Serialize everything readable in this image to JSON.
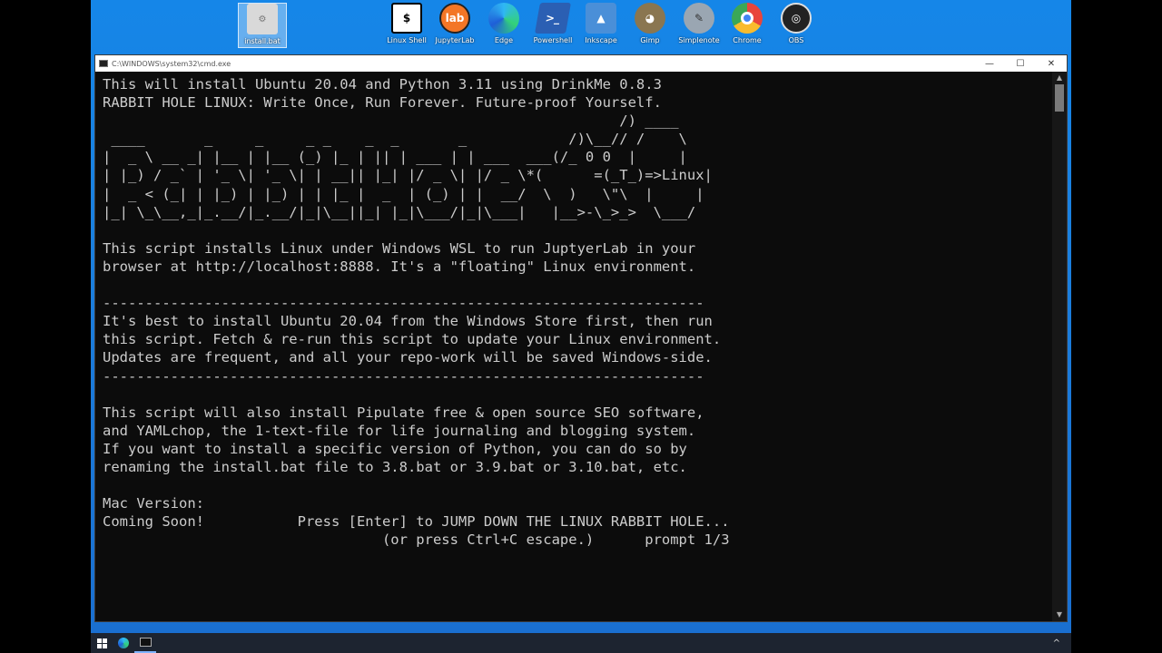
{
  "desktop": {
    "icons": [
      {
        "label": "install.bat",
        "icon": "batch-file-icon",
        "color": "#d9d9d9"
      },
      {
        "label": "Linux Shell",
        "icon": "linux-shell-icon",
        "color": "#ffffff"
      },
      {
        "label": "JupyterLab",
        "icon": "jupyterlab-icon",
        "color": "#f37626",
        "glyph": "lab"
      },
      {
        "label": "Edge",
        "icon": "edge-icon",
        "color": "#1e8fe0"
      },
      {
        "label": "Powershell",
        "icon": "powershell-icon",
        "color": "#2b5fb3"
      },
      {
        "label": "Inkscape",
        "icon": "inkscape-icon",
        "color": "#4a8fd8"
      },
      {
        "label": "Gimp",
        "icon": "gimp-icon",
        "color": "#6b5a3e"
      },
      {
        "label": "Simplenote",
        "icon": "simplenote-icon",
        "color": "#7b8a9a"
      },
      {
        "label": "Chrome",
        "icon": "chrome-icon",
        "color": "#e8453c"
      },
      {
        "label": "OBS",
        "icon": "obs-icon",
        "color": "#222222"
      }
    ]
  },
  "window": {
    "title": "C:\\WINDOWS\\system32\\cmd.exe",
    "minimize": "—",
    "maximize": "☐",
    "close": "✕"
  },
  "console": {
    "text": "This will install Ubuntu 20.04 and Python 3.11 using DrinkMe 0.8.3\nRABBIT HOLE LINUX: Write Once, Run Forever. Future-proof Yourself.\n                                                             /) ____\n ____       _     _     _ _    _  _       _            /)\\__// /    \\\n|  _ \\ __ _| |__ | |__ (_) |_ | || | ___ | | ___  ___(/_ 0 0  |     |\n| |_) / _` | '_ \\| '_ \\| | __|| |_| |/ _ \\| |/ _ \\*(      =(_T_)=>Linux|\n|  _ < (_| | |_) | |_) | | |_ |  _  | (_) | |  __/  \\  )   \\\"\\  |     |\n|_| \\_\\__,_|_.__/|_.__/|_|\\__||_| |_|\\___/|_|\\___|   |__>-\\_>_>  \\___/\n\nThis script installs Linux under Windows WSL to run JuptyerLab in your\nbrowser at http://localhost:8888. It's a \"floating\" Linux environment.\n\n-----------------------------------------------------------------------\nIt's best to install Ubuntu 20.04 from the Windows Store first, then run\nthis script. Fetch & re-run this script to update your Linux environment.\nUpdates are frequent, and all your repo-work will be saved Windows-side.\n-----------------------------------------------------------------------\n\nThis script will also install Pipulate free & open source SEO software,\nand YAMLchop, the 1-text-file for life journaling and blogging system.\nIf you want to install a specific version of Python, you can do so by\nrenaming the install.bat file to 3.8.bat or 3.9.bat or 3.10.bat, etc.\n\nMac Version:\nComing Soon!           Press [Enter] to JUMP DOWN THE LINUX RABBIT HOLE...\n                                 (or press Ctrl+C escape.)      prompt 1/3"
  },
  "taskbar": {
    "start": "start-icon",
    "items": [
      "edge-icon",
      "cmd-icon"
    ],
    "tray_chevron": "^"
  }
}
